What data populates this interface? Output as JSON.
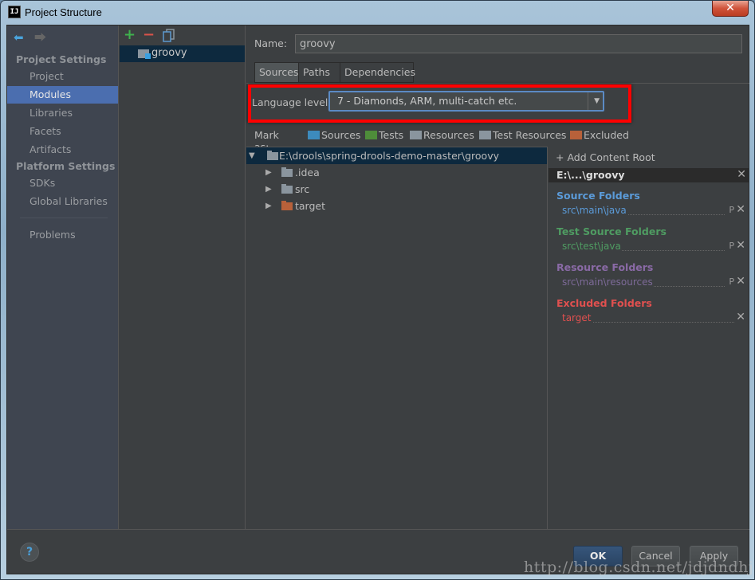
{
  "window": {
    "title": "Project Structure",
    "app_icon": "IJ",
    "close_glyph": "✕"
  },
  "nav": {
    "back_icon": "🡄",
    "forward_icon": "🡆",
    "sections": [
      {
        "title": "Project Settings",
        "items": [
          "Project",
          "Modules",
          "Libraries",
          "Facets",
          "Artifacts"
        ]
      },
      {
        "title": "Platform Settings",
        "items": [
          "SDKs",
          "Global Libraries"
        ]
      }
    ],
    "extra_items": [
      "Problems"
    ],
    "active_item": "Modules"
  },
  "modules": {
    "toolbar": {
      "add": "+",
      "remove": "−"
    },
    "items": [
      {
        "label": "groovy",
        "selected": true
      }
    ]
  },
  "editor": {
    "name_label": "Name:",
    "name_value": "groovy",
    "tabs": [
      {
        "label": "Sources",
        "active": true
      },
      {
        "label": "Paths",
        "active": false
      },
      {
        "label": "Dependencies",
        "active": false
      }
    ],
    "language_level_label": "Language level:",
    "language_level_value": "7 - Diamonds, ARM, multi-catch etc.",
    "dropdown_arrow": "▼",
    "mark_as": {
      "label": "Mark as:",
      "options": [
        {
          "label": "Sources",
          "color": "#3d8bbd"
        },
        {
          "label": "Tests",
          "color": "#4e8d3a"
        },
        {
          "label": "Resources",
          "color": "#8a959e"
        },
        {
          "label": "Test Resources",
          "color": "#8a959e"
        },
        {
          "label": "Excluded",
          "color": "#b8613a"
        }
      ]
    },
    "tree": {
      "root": {
        "label": "E:\\drools\\spring-drools-demo-master\\groovy",
        "expanded": true
      },
      "children": [
        {
          "label": ".idea",
          "type": "normal"
        },
        {
          "label": "src",
          "type": "normal"
        },
        {
          "label": "target",
          "type": "excluded"
        }
      ]
    }
  },
  "content_roots": {
    "add_label": "Add Content Root",
    "root_title": "E:\\...\\groovy",
    "groups": [
      {
        "title": "Source Folders",
        "color": "#5b9bd9",
        "path_color": "#5b9bd9",
        "paths": [
          "src\\main\\java"
        ],
        "has_package_prefix": true
      },
      {
        "title": "Test Source Folders",
        "color": "#4f9c62",
        "path_color": "#4f9c62",
        "paths": [
          "src\\test\\java"
        ],
        "has_package_prefix": true
      },
      {
        "title": "Resource Folders",
        "color": "#8a6aa6",
        "path_color": "#7d6a98",
        "paths": [
          "src\\main\\resources"
        ],
        "has_package_prefix": true
      },
      {
        "title": "Excluded Folders",
        "color": "#e0504f",
        "path_color": "#e0504f",
        "paths": [
          "target"
        ],
        "has_package_prefix": false
      }
    ],
    "package_prefix_glyph": "P",
    "remove_glyph": "✕"
  },
  "footer": {
    "help": "?",
    "ok": "OK",
    "cancel": "Cancel",
    "apply": "Apply",
    "watermark": "http://blog.csdn.net/jdjdndhj"
  },
  "highlight": {
    "color": "#ff0000",
    "target": "language-level"
  }
}
